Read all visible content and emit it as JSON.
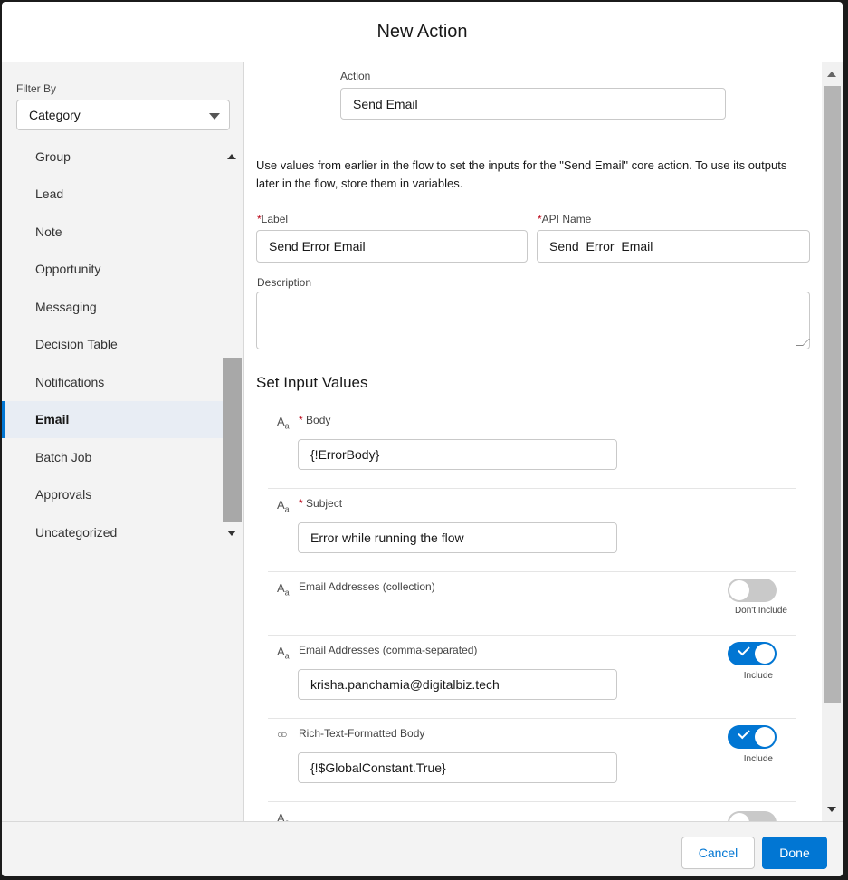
{
  "modal": {
    "title": "New Action"
  },
  "sidebar": {
    "filter_label": "Filter By",
    "filter_value": "Category",
    "categories": [
      "Group",
      "Lead",
      "Note",
      "Opportunity",
      "Messaging",
      "Decision Table",
      "Notifications",
      "Email",
      "Batch Job",
      "Approvals",
      "Uncategorized"
    ],
    "active_category": "Email"
  },
  "main": {
    "action_label": "Action",
    "action_value": "Send Email",
    "description_text": "Use values from earlier in the flow to set the inputs for the \"Send Email\" core action. To use its outputs later in the flow, store them in variables.",
    "label_field": {
      "label": "Label",
      "value": "Send Error Email"
    },
    "api_name_field": {
      "label": "API Name",
      "value": "Send_Error_Email"
    },
    "description_field": {
      "label": "Description",
      "value": ""
    },
    "section_title": "Set Input Values",
    "params": [
      {
        "label": "Body",
        "required": "*",
        "value": "{!ErrorBody}",
        "type_icon": "text-icon"
      },
      {
        "label": "Subject",
        "required": "*",
        "value": "Error while running the flow",
        "type_icon": "text-icon"
      },
      {
        "label": "Email Addresses (collection)",
        "toggle": "off",
        "toggle_text": "Don't Include",
        "type_icon": "text-icon"
      },
      {
        "label": "Email Addresses (comma-separated)",
        "value": "krisha.panchamia@digitalbiz.tech",
        "toggle": "on",
        "toggle_text": "Include",
        "type_icon": "text-icon"
      },
      {
        "label": "Rich-Text-Formatted Body",
        "value": "{!$GlobalConstant.True}",
        "toggle": "on",
        "toggle_text": "Include",
        "type_icon": "boolean-icon"
      }
    ]
  },
  "footer": {
    "cancel_label": "Cancel",
    "done_label": "Done"
  },
  "colors": {
    "brand": "#0176d3",
    "required": "#ba0517",
    "active_bg": "#e8edf4"
  }
}
